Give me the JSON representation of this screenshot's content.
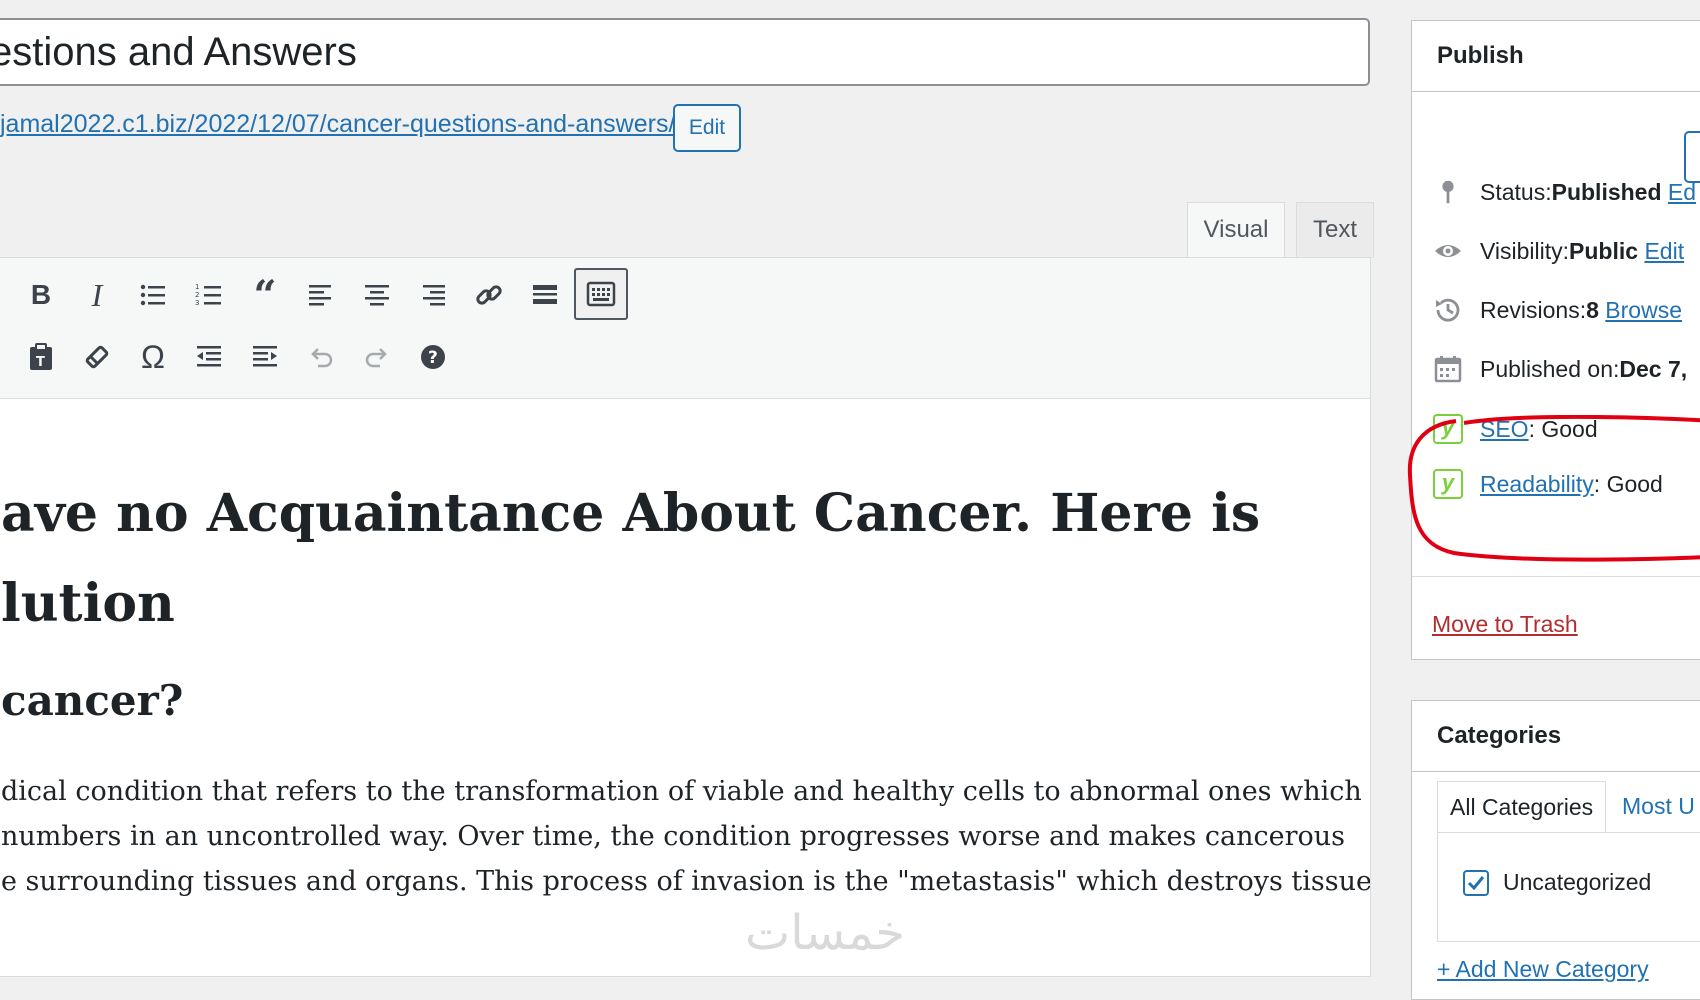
{
  "post": {
    "title": "estions and Answers",
    "permalink": "jamal2022.c1.biz/2022/12/07/cancer-questions-and-answers/",
    "permalink_edit_label": "Edit"
  },
  "editor": {
    "tabs": {
      "visual": "Visual",
      "text": "Text"
    },
    "toolbar_row1": [
      "bold-icon",
      "italic-icon",
      "bulleted-list-icon",
      "numbered-list-icon",
      "blockquote-icon",
      "align-left-icon",
      "align-center-icon",
      "align-right-icon",
      "link-icon",
      "read-more-icon",
      "toolbar-toggle-icon"
    ],
    "toolbar_row2": [
      "paste-as-text-icon",
      "clear-formatting-icon",
      "special-character-icon",
      "outdent-icon",
      "indent-icon",
      "undo-icon",
      "redo-icon",
      "help-icon"
    ],
    "heading1_line1": "ave no Acquaintance About Cancer. Here is",
    "heading1_line2": "lution",
    "heading2": "cancer?",
    "paragraph_lines": [
      "dical condition that refers to the transformation of viable and healthy cells to abnormal ones which",
      "numbers in an uncontrolled way. Over time, the condition progresses worse and makes cancerous",
      "e surrounding tissues and organs. This process of invasion is the \"metastasis\" which destroys tissues,"
    ]
  },
  "publish": {
    "title": "Publish",
    "status_label": "Status: ",
    "status_value": "Published",
    "status_edit": "Ed",
    "visibility_label": "Visibility: ",
    "visibility_value": "Public",
    "visibility_edit": "Edit",
    "revisions_label": "Revisions: ",
    "revisions_value": "8",
    "revisions_browse": "Browse",
    "published_label": "Published on: ",
    "published_value": "Dec 7,",
    "seo_link": "SEO",
    "seo_value": ": Good",
    "readability_link": "Readability",
    "readability_value": ": Good",
    "trash": "Move to Trash",
    "yoast_glyph": "y"
  },
  "categories": {
    "title": "Categories",
    "tab_all": "All Categories",
    "tab_most": "Most U",
    "item": "Uncategorized",
    "add_new": "+ Add New Category"
  },
  "watermark": "خمسات",
  "colors": {
    "accent": "#2271b1",
    "trash": "#b32d2e",
    "yoast": "#7ad03a",
    "annotation": "#e00012"
  }
}
